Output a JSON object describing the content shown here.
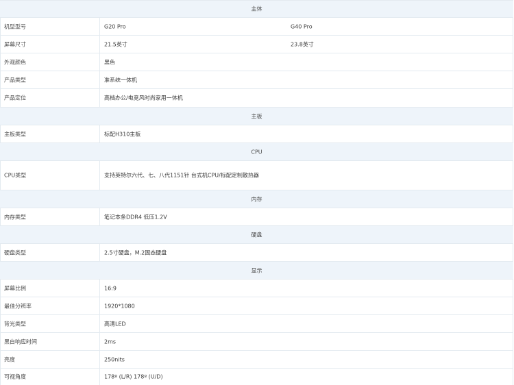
{
  "sections": {
    "main": "主体",
    "board": "主板",
    "cpu": "CPU",
    "memory": "内存",
    "disk": "硬盘",
    "display": "显示"
  },
  "rows": {
    "model": {
      "label": "机型型号",
      "v1": "G20 Pro",
      "v2": "G40 Pro"
    },
    "screen_size": {
      "label": "屏幕尺寸",
      "v1": "21.5英寸",
      "v2": "23.8英寸"
    },
    "color": {
      "label": "外观颜色",
      "v1": "黑色"
    },
    "product_type": {
      "label": "产品类型",
      "v1": "准系统一体机"
    },
    "positioning": {
      "label": "产品定位",
      "v1": "高档办公/电竞风时尚家用一体机"
    },
    "board_type": {
      "label": "主板类型",
      "v1": "标配H310主板"
    },
    "cpu_type": {
      "label": "CPU类型",
      "v1": "支持英特尔六代、七、八代1151针 台式机CPU/标配定制散热器"
    },
    "memory_type": {
      "label": "内存类型",
      "v1": "笔记本条DDR4 低压1.2V"
    },
    "disk_type": {
      "label": "硬盘类型",
      "v1": "2.5寸硬盘，M.2固态硬盘"
    },
    "ratio": {
      "label": "屏幕比例",
      "v1": "16:9"
    },
    "resolution": {
      "label": "最佳分辨率",
      "v1": "1920*1080"
    },
    "backlight": {
      "label": "背光类型",
      "v1": "高清LED"
    },
    "response": {
      "label": "黑白响应时间",
      "v1": "2ms"
    },
    "brightness": {
      "label": "亮度",
      "v1": "250nits"
    },
    "view_angle": {
      "label": "可视角度",
      "v1": "178º (L/R)  178º (U/D)"
    }
  }
}
